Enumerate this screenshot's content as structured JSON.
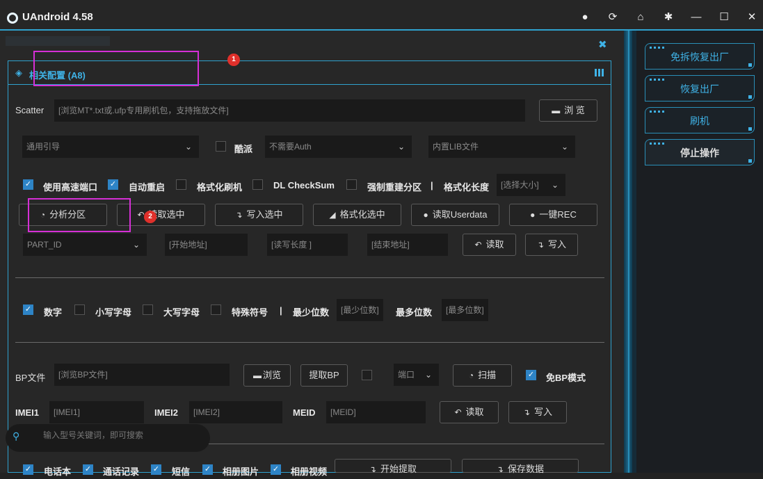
{
  "app": {
    "title": "UAndroid 4.58"
  },
  "sidebar": {
    "items": [
      {
        "label": "免拆恢复出厂"
      },
      {
        "label": "恢复出厂"
      },
      {
        "label": "刷机"
      },
      {
        "label": "停止操作"
      }
    ]
  },
  "panel": {
    "title": "相关配置 (A8)",
    "scatter": {
      "label": "Scatter",
      "placeholder": "[浏览MT*.txt或.ufp专用刷机包，支持拖放文件]",
      "browse_label": "浏 览"
    },
    "boot_select": {
      "value": "通用引导"
    },
    "kupai": {
      "label": "酷派"
    },
    "auth_select": {
      "value": "不需要Auth"
    },
    "lib_select": {
      "value": "内置LIB文件"
    },
    "options": {
      "high_speed_port": "使用高速端口",
      "auto_restart": "自动重启",
      "format_flash": "格式化刷机",
      "dl_checksum": "DL CheckSum",
      "force_rebuild": "强制重建分区",
      "separator": "|",
      "format_length_label": "格式化长度",
      "size_select": "[选择大小]"
    },
    "actions": {
      "analyze": "分析分区",
      "read_selected": "读取选中",
      "write_selected": "写入选中",
      "format_selected": "格式化选中",
      "read_userdata": "读取Userdata",
      "one_key_rec": "一键REC"
    },
    "partition": {
      "part_id": "PART_ID",
      "start_placeholder": "[开始地址]",
      "length_placeholder": "[读写长度 ]",
      "end_placeholder": "[结束地址]",
      "read_label": "读取",
      "write_label": "写入"
    },
    "charset": {
      "digits": "数字",
      "lower": "小写字母",
      "upper": "大写字母",
      "special": "特殊符号",
      "separator": "|",
      "min_label": "最少位数",
      "min_placeholder": "[最少位数]",
      "max_label": "最多位数",
      "max_placeholder": "[最多位数]"
    },
    "bp": {
      "label": "BP文件",
      "placeholder": "[浏览BP文件]",
      "browse_label": "浏览",
      "extract_label": "提取BP",
      "port_select": "端口",
      "scan_label": "扫描",
      "free_bp_label": "免BP模式"
    },
    "imei": {
      "imei1_label": "IMEI1",
      "imei1_placeholder": "[IMEI1]",
      "imei2_label": "IMEI2",
      "imei2_placeholder": "[IMEI2]",
      "meid_label": "MEID",
      "meid_placeholder": "[MEID]",
      "read_label": "读取",
      "write_label": "写入"
    },
    "data": {
      "contacts": "电话本",
      "call_log": "通话记录",
      "sms": "短信",
      "photos": "相册图片",
      "videos": "相册视频",
      "start_extract": "开始提取",
      "save_data": "保存数据"
    }
  },
  "search": {
    "placeholder": "输入型号关键词，即可搜索"
  },
  "annotations": {
    "badge1": "1",
    "badge2": "2"
  },
  "colors": {
    "accent": "#2fa2cf",
    "highlight": "#d62fd6",
    "badge": "#e0302b",
    "checkbox": "#2e84c6"
  }
}
